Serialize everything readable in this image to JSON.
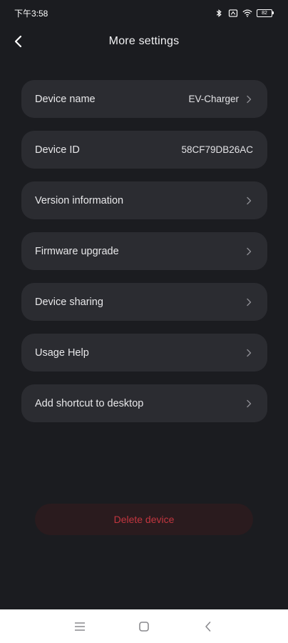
{
  "status": {
    "time": "下午3:58",
    "battery": "82"
  },
  "header": {
    "title": "More settings"
  },
  "rows": [
    {
      "label": "Device name",
      "value": "EV-Charger",
      "chevron": true
    },
    {
      "label": "Device ID",
      "value": "58CF79DB26AC",
      "chevron": false
    },
    {
      "label": "Version information",
      "value": "",
      "chevron": true
    },
    {
      "label": "Firmware upgrade",
      "value": "",
      "chevron": true
    },
    {
      "label": "Device sharing",
      "value": "",
      "chevron": true
    },
    {
      "label": "Usage Help",
      "value": "",
      "chevron": true
    },
    {
      "label": "Add shortcut to desktop",
      "value": "",
      "chevron": true
    }
  ],
  "delete": {
    "label": "Delete device"
  },
  "colors": {
    "background": "#1b1c20",
    "row": "#2b2c31",
    "danger": "#c2363f"
  },
  "icons": {
    "back": "chevron-left-icon",
    "row_chevron": "chevron-right-icon",
    "nav": [
      "menu-icon",
      "home-icon",
      "back-icon"
    ]
  }
}
